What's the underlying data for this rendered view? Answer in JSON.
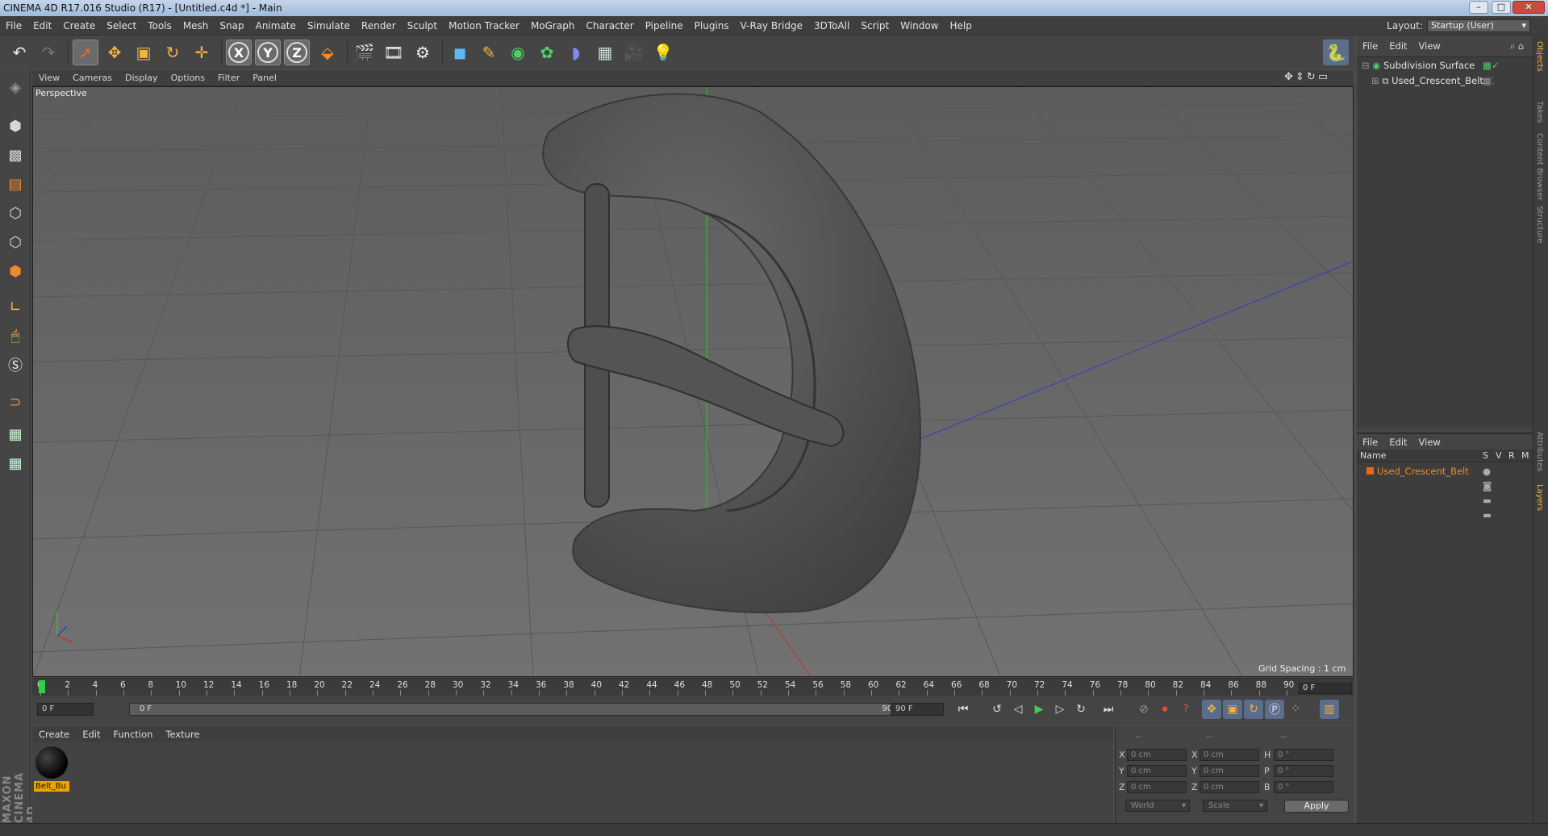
{
  "window": {
    "title": "CINEMA 4D R17.016 Studio (R17) - [Untitled.c4d *] - Main"
  },
  "menubar": {
    "items": [
      "File",
      "Edit",
      "Create",
      "Select",
      "Tools",
      "Mesh",
      "Snap",
      "Animate",
      "Simulate",
      "Render",
      "Sculpt",
      "Motion Tracker",
      "MoGraph",
      "Character",
      "Pipeline",
      "Plugins",
      "V-Ray Bridge",
      "3DToAll",
      "Script",
      "Window",
      "Help"
    ]
  },
  "layout": {
    "label": "Layout:",
    "value": "Startup (User)"
  },
  "viewport": {
    "menu": [
      "View",
      "Cameras",
      "Display",
      "Options",
      "Filter",
      "Panel"
    ],
    "label": "Perspective",
    "grid_spacing": "Grid Spacing : 1 cm",
    "object": "belt buckle",
    "colors": {
      "background": "#6b6b6b",
      "grid": "#5a5a5a",
      "y_axis": "#2fbf2f",
      "x_axis": "#c0302a",
      "z_axis": "#2f3fbf"
    }
  },
  "timeline": {
    "ticks": [
      "0",
      "2",
      "4",
      "6",
      "8",
      "10",
      "12",
      "14",
      "16",
      "18",
      "20",
      "22",
      "24",
      "26",
      "28",
      "30",
      "32",
      "34",
      "36",
      "38",
      "40",
      "42",
      "44",
      "46",
      "48",
      "50",
      "52",
      "54",
      "56",
      "58",
      "60",
      "62",
      "64",
      "66",
      "68",
      "70",
      "72",
      "74",
      "76",
      "78",
      "80",
      "82",
      "84",
      "86",
      "88",
      "90"
    ],
    "current": "0 F"
  },
  "transport": {
    "start": "0 F",
    "slider_start": "0 F",
    "slider_end": "90 F",
    "end": "90 F"
  },
  "material": {
    "menu": [
      "Create",
      "Edit",
      "Function",
      "Texture"
    ],
    "name": "Belt_Bu"
  },
  "attributes": {
    "header": [
      "--",
      "--",
      "--"
    ],
    "rows": [
      {
        "l1": "X",
        "v1": "0 cm",
        "l2": "X",
        "v2": "0 cm",
        "l3": "H",
        "v3": "0 °"
      },
      {
        "l1": "Y",
        "v1": "0 cm",
        "l2": "Y",
        "v2": "0 cm",
        "l3": "P",
        "v3": "0 °"
      },
      {
        "l1": "Z",
        "v1": "0 cm",
        "l2": "Z",
        "v2": "0 cm",
        "l3": "B",
        "v3": "0 °"
      }
    ],
    "coord_mode": "World",
    "transform_mode": "Scale",
    "apply": "Apply"
  },
  "objects": {
    "menu": [
      "File",
      "Edit",
      "View"
    ],
    "items": [
      {
        "name": "Subdivision Surface",
        "icon": "subdivision-icon"
      },
      {
        "name": "Used_Crescent_Belt",
        "icon": "layer-object-icon"
      }
    ]
  },
  "layers": {
    "menu": [
      "File",
      "Edit",
      "View"
    ],
    "header": {
      "name": "Name",
      "cols": [
        "S",
        "V",
        "R",
        "M"
      ]
    },
    "items": [
      {
        "name": "Used_Crescent_Belt",
        "color": "#e5691f"
      }
    ]
  },
  "side_tabs": [
    "Objects",
    "Takes",
    "Content Browser",
    "Structure",
    "Attributes",
    "Layers"
  ],
  "brand": "MAXON CINEMA 4D"
}
